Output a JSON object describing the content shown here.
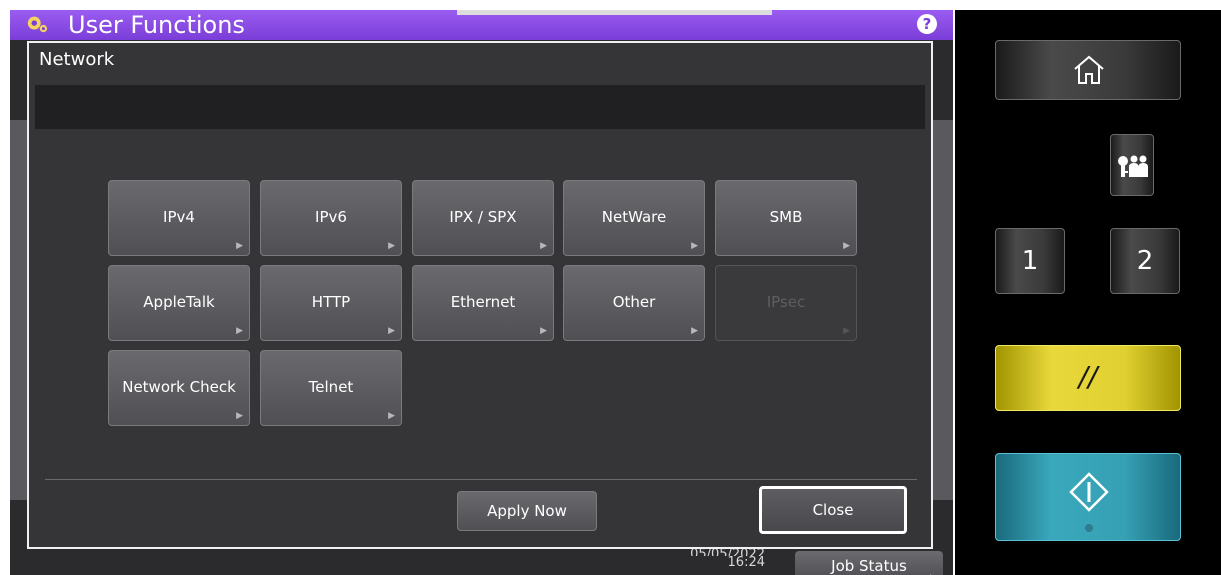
{
  "header": {
    "title": "User Functions",
    "help_label": "?"
  },
  "dialog": {
    "title": "Network",
    "buttons": [
      {
        "label": "IPv4",
        "enabled": true
      },
      {
        "label": "IPv6",
        "enabled": true
      },
      {
        "label": "IPX / SPX",
        "enabled": true
      },
      {
        "label": "NetWare",
        "enabled": true
      },
      {
        "label": "SMB",
        "enabled": true
      },
      {
        "label": "AppleTalk",
        "enabled": true
      },
      {
        "label": "HTTP",
        "enabled": true
      },
      {
        "label": "Ethernet",
        "enabled": true
      },
      {
        "label": "Other",
        "enabled": true
      },
      {
        "label": "IPsec",
        "enabled": false
      },
      {
        "label": "Network Check",
        "enabled": true
      },
      {
        "label": "Telnet",
        "enabled": true
      }
    ],
    "apply_label": "Apply Now",
    "close_label": "Close"
  },
  "status": {
    "date": "05/05/2022",
    "time": "16:24",
    "job_status_label": "Job Status"
  },
  "side_panel": {
    "home_icon": "home-icon",
    "user_icon": "user-login-icon",
    "num1_label": "1",
    "num2_label": "2",
    "reset_label": "//",
    "start_icon": "start-icon"
  },
  "colors": {
    "title_bar": "#8a4ee6",
    "reset": "#e0d030",
    "start": "#36a0b4"
  }
}
